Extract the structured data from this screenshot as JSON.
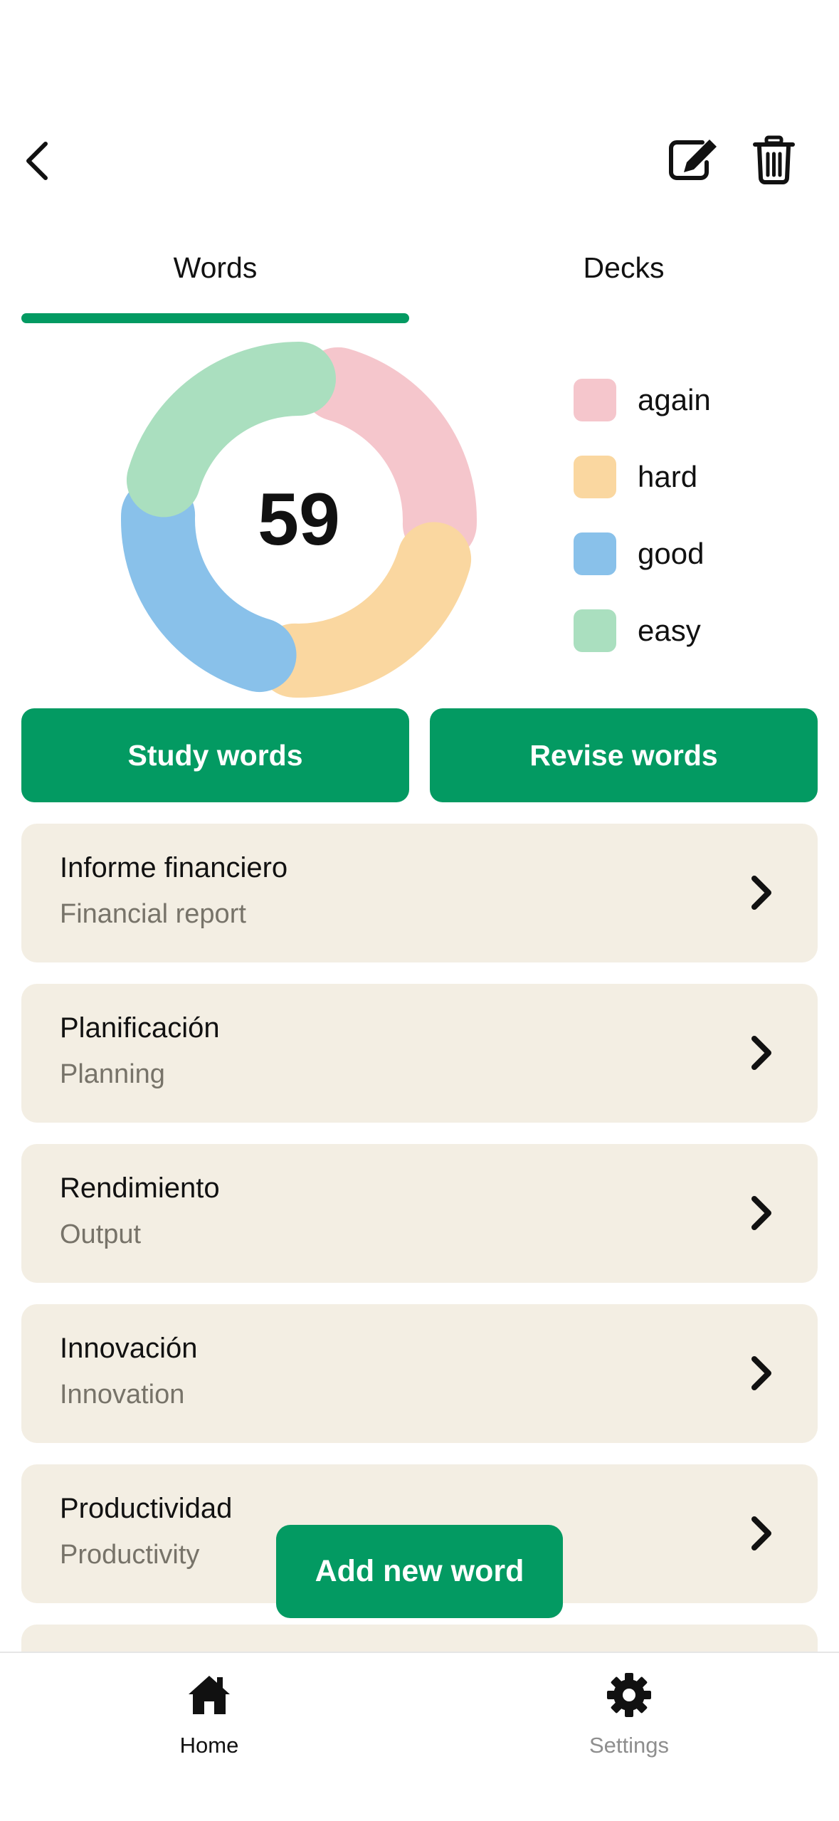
{
  "header": {
    "back_icon": "chevron-left-icon",
    "edit_icon": "edit-icon",
    "delete_icon": "trash-icon"
  },
  "tabs": [
    {
      "label": "Words",
      "active": true
    },
    {
      "label": "Decks",
      "active": false
    }
  ],
  "stats": {
    "total": "59",
    "legend": [
      {
        "label": "again",
        "color": "#f5c6cc"
      },
      {
        "label": "hard",
        "color": "#fad7a0"
      },
      {
        "label": "good",
        "color": "#89c1ea"
      },
      {
        "label": "easy",
        "color": "#aadfbf"
      }
    ]
  },
  "actions": {
    "study_label": "Study words",
    "revise_label": "Revise words"
  },
  "words": [
    {
      "term": "Informe financiero",
      "translation": "Financial report"
    },
    {
      "term": "Planificación",
      "translation": "Planning"
    },
    {
      "term": "Rendimiento",
      "translation": "Output"
    },
    {
      "term": "Innovación",
      "translation": "Innovation"
    },
    {
      "term": "Productividad",
      "translation": "Productivity"
    }
  ],
  "add_button_label": "Add new word",
  "bottom_nav": [
    {
      "label": "Home",
      "icon": "home-icon",
      "active": true
    },
    {
      "label": "Settings",
      "icon": "gear-icon",
      "active": false
    }
  ],
  "colors": {
    "accent": "#039a62",
    "card_bg": "#f3eee3",
    "muted_text": "#777369",
    "inactive_nav": "#8e8e8e"
  }
}
